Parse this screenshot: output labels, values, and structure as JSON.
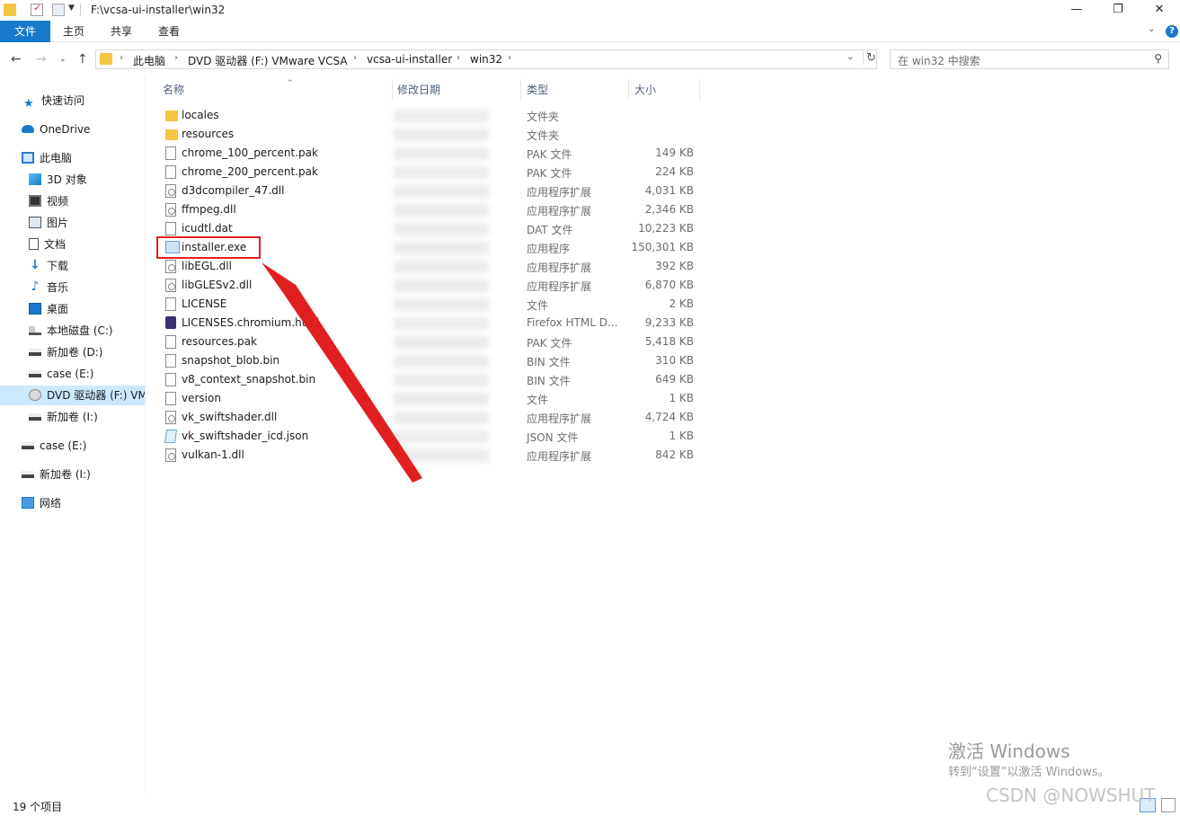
{
  "window": {
    "title_path": "F:\\vcsa-ui-installer\\win32",
    "minimize_label": "—",
    "maximize_label": "❐",
    "close_label": "✕"
  },
  "ribbon": {
    "file_tab": "文件",
    "home_tab": "主页",
    "share_tab": "共享",
    "view_tab": "查看",
    "help_label": "?"
  },
  "address": {
    "crumbs": [
      "此电脑",
      "DVD 驱动器 (F:) VMware VCSA",
      "vcsa-ui-installer",
      "win32"
    ],
    "search_placeholder": "在 win32 中搜索"
  },
  "nav_pane": {
    "items": [
      {
        "label": "快速访问",
        "icon": "star-icon"
      },
      {
        "label": "OneDrive",
        "icon": "cloud-icon"
      },
      {
        "label": "此电脑",
        "icon": "computer-icon"
      },
      {
        "label": "3D 对象",
        "icon": "3d-objects-icon"
      },
      {
        "label": "视频",
        "icon": "video-icon"
      },
      {
        "label": "图片",
        "icon": "pictures-icon"
      },
      {
        "label": "文档",
        "icon": "documents-icon"
      },
      {
        "label": "下载",
        "icon": "download-icon"
      },
      {
        "label": "音乐",
        "icon": "music-icon"
      },
      {
        "label": "桌面",
        "icon": "desktop-icon"
      },
      {
        "label": "本地磁盘 (C:)",
        "icon": "windows-drive-icon"
      },
      {
        "label": "新加卷 (D:)",
        "icon": "drive-icon"
      },
      {
        "label": "case (E:)",
        "icon": "drive-icon"
      },
      {
        "label": "DVD 驱动器 (F:) VMware VCSA",
        "icon": "dvd-drive-icon",
        "selected": true
      },
      {
        "label": "新加卷 (I:)",
        "icon": "drive-icon"
      },
      {
        "label": "case (E:)",
        "icon": "drive-icon"
      },
      {
        "label": "新加卷 (I:)",
        "icon": "drive-icon"
      },
      {
        "label": "网络",
        "icon": "network-icon"
      }
    ]
  },
  "columns": {
    "name": "名称",
    "modified": "修改日期",
    "type": "类型",
    "size": "大小"
  },
  "files": [
    {
      "name": "locales",
      "type": "文件夹",
      "size": "",
      "icon": "folder-icon"
    },
    {
      "name": "resources",
      "type": "文件夹",
      "size": "",
      "icon": "folder-icon"
    },
    {
      "name": "chrome_100_percent.pak",
      "type": "PAK 文件",
      "size": "149 KB",
      "icon": "file-icon"
    },
    {
      "name": "chrome_200_percent.pak",
      "type": "PAK 文件",
      "size": "224 KB",
      "icon": "file-icon"
    },
    {
      "name": "d3dcompiler_47.dll",
      "type": "应用程序扩展",
      "size": "4,031 KB",
      "icon": "dll-icon"
    },
    {
      "name": "ffmpeg.dll",
      "type": "应用程序扩展",
      "size": "2,346 KB",
      "icon": "dll-icon"
    },
    {
      "name": "icudtl.dat",
      "type": "DAT 文件",
      "size": "10,223 KB",
      "icon": "file-icon"
    },
    {
      "name": "installer.exe",
      "type": "应用程序",
      "size": "150,301 KB",
      "icon": "exe-icon"
    },
    {
      "name": "libEGL.dll",
      "type": "应用程序扩展",
      "size": "392 KB",
      "icon": "dll-icon"
    },
    {
      "name": "libGLESv2.dll",
      "type": "应用程序扩展",
      "size": "6,870 KB",
      "icon": "dll-icon"
    },
    {
      "name": "LICENSE",
      "type": "文件",
      "size": "2 KB",
      "icon": "file-icon"
    },
    {
      "name": "LICENSES.chromium.html",
      "type": "Firefox HTML D...",
      "size": "9,233 KB",
      "icon": "firefox-html-icon"
    },
    {
      "name": "resources.pak",
      "type": "PAK 文件",
      "size": "5,418 KB",
      "icon": "file-icon"
    },
    {
      "name": "snapshot_blob.bin",
      "type": "BIN 文件",
      "size": "310 KB",
      "icon": "file-icon"
    },
    {
      "name": "v8_context_snapshot.bin",
      "type": "BIN 文件",
      "size": "649 KB",
      "icon": "file-icon"
    },
    {
      "name": "version",
      "type": "文件",
      "size": "1 KB",
      "icon": "file-icon"
    },
    {
      "name": "vk_swiftshader.dll",
      "type": "应用程序扩展",
      "size": "4,724 KB",
      "icon": "dll-icon"
    },
    {
      "name": "vk_swiftshader_icd.json",
      "type": "JSON 文件",
      "size": "1 KB",
      "icon": "json-icon"
    },
    {
      "name": "vulkan-1.dll",
      "type": "应用程序扩展",
      "size": "842 KB",
      "icon": "dll-icon"
    }
  ],
  "status": {
    "item_count": "19 个项目"
  },
  "watermark": {
    "activate_title": "激活 Windows",
    "activate_sub": "转到“设置”以激活 Windows。",
    "csdn": "CSDN @NOWSHUT"
  },
  "colors": {
    "accent": "#1979ca",
    "annotation_red": "#e02020",
    "selection": "#cce8ff"
  }
}
